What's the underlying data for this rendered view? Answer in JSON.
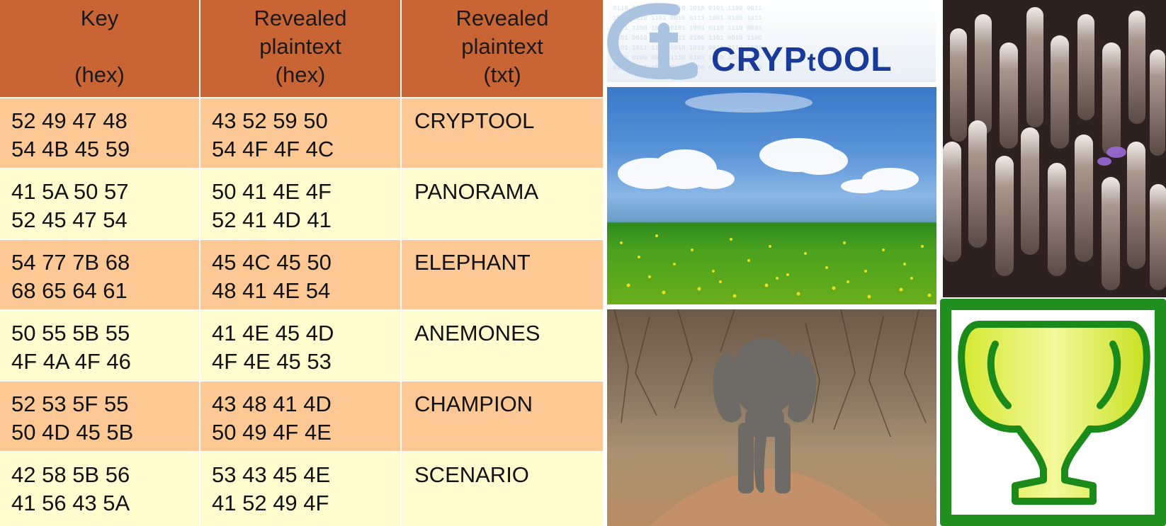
{
  "table": {
    "headers": [
      {
        "line1": "Key",
        "line2": "",
        "line3": "(hex)"
      },
      {
        "line1": "Revealed",
        "line2": "plaintext",
        "line3": "(hex)"
      },
      {
        "line1": "Revealed",
        "line2": "plaintext",
        "line3": "(txt)"
      }
    ],
    "rows": [
      {
        "key1": "52 49 47 48",
        "key2": "54 4B 45 59",
        "pt1": "43 52 59 50",
        "pt2": "54 4F 4F 4C",
        "txt": "CRYPTOOL"
      },
      {
        "key1": "41 5A 50 57",
        "key2": "52 45 47 54",
        "pt1": "50 41 4E 4F",
        "pt2": "52 41 4D 41",
        "txt": "PANORAMA"
      },
      {
        "key1": "54 77 7B 68",
        "key2": "68 65 64 61",
        "pt1": "45 4C 45 50",
        "pt2": "48 41 4E 54",
        "txt": "ELEPHANT"
      },
      {
        "key1": "50 55 5B 55",
        "key2": "4F 4A 4F 46",
        "pt1": "41 4E 45 4D",
        "pt2": "4F 4E 45 53",
        "txt": "ANEMONES"
      },
      {
        "key1": "52 53 5F 55",
        "key2": "50 4D 45 5B",
        "pt1": "43 48 41 4D",
        "pt2": "50 49 4F 4E",
        "txt": "CHAMPION"
      },
      {
        "key1": "42 58 5B 56",
        "key2": "41 56 43 5A",
        "pt1": "53 43 45 4E",
        "pt2": "41 52 49 4F",
        "txt": "SCENARIO"
      }
    ]
  },
  "logo": {
    "text_main": "CRYP",
    "text_t": "t",
    "text_end": "OOL"
  },
  "colors": {
    "header_bg": "#c96434",
    "row_dark": "#fec894",
    "row_light": "#fffdcf",
    "logo_blue": "#1a3a9a",
    "trophy_green": "#1a8a1a",
    "trophy_yellow": "#e6f064"
  },
  "images": [
    "cryptool-logo",
    "meadow-sky-photo",
    "elephant-photo",
    "anemone-photo",
    "trophy-icon"
  ]
}
